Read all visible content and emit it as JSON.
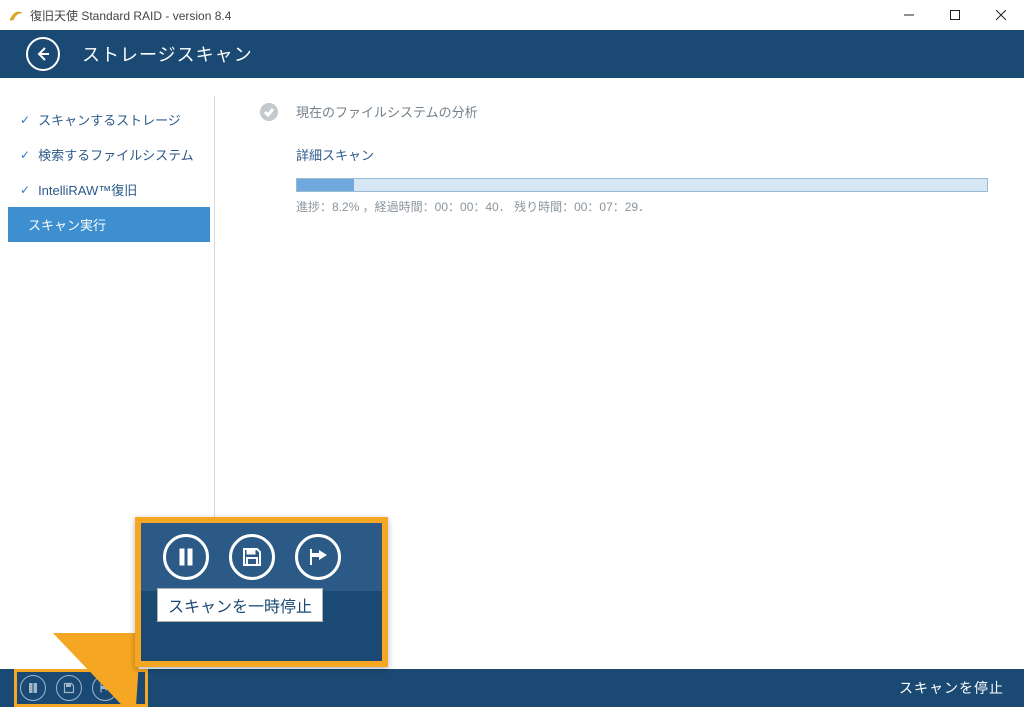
{
  "window": {
    "title": "復旧天使 Standard RAID - version 8.4"
  },
  "header": {
    "title": "ストレージスキャン"
  },
  "sidebar": {
    "items": [
      {
        "label": "スキャンするストレージ",
        "checked": true,
        "active": false
      },
      {
        "label": "検索するファイルシステム",
        "checked": true,
        "active": false
      },
      {
        "label": "IntelliRAW™復旧",
        "checked": true,
        "active": false
      },
      {
        "label": "スキャン実行",
        "checked": false,
        "active": true
      }
    ]
  },
  "content": {
    "completed_step": "現在のファイルシステムの分析",
    "current_section": "詳細スキャン",
    "progress": {
      "percent": 8.2,
      "text": "進捗：8.2% ，経過時間：00：00：40． 残り時間：00：07：29．"
    }
  },
  "footer": {
    "icons": [
      "pause-icon",
      "save-icon",
      "skip-icon"
    ],
    "stop_label": "スキャンを停止"
  },
  "callout": {
    "tooltip": "スキャンを一時停止"
  }
}
